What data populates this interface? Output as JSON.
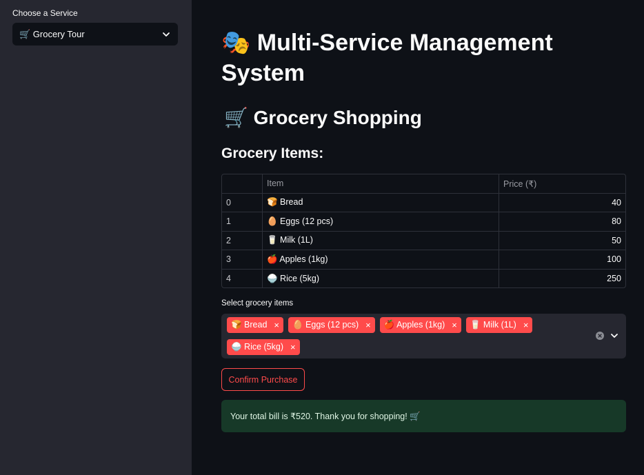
{
  "sidebar": {
    "label": "Choose a Service",
    "selected": "🛒 Grocery Tour"
  },
  "main": {
    "title": "🎭 Multi-Service Management System",
    "subtitle": "🛒 Grocery Shopping",
    "section_heading": "Grocery Items:",
    "table": {
      "columns": [
        "",
        "Item",
        "Price (₹)"
      ],
      "rows": [
        {
          "index": "0",
          "item": "🍞 Bread",
          "price": "40"
        },
        {
          "index": "1",
          "item": "🥚 Eggs (12 pcs)",
          "price": "80"
        },
        {
          "index": "2",
          "item": "🥛 Milk (1L)",
          "price": "50"
        },
        {
          "index": "3",
          "item": "🍎 Apples (1kg)",
          "price": "100"
        },
        {
          "index": "4",
          "item": "🍚 Rice (5kg)",
          "price": "250"
        }
      ]
    },
    "multiselect": {
      "label": "Select grocery items",
      "tags": [
        "🍞 Bread",
        "🥚 Eggs (12 pcs)",
        "🍎 Apples (1kg)",
        "🥛 Milk (1L)",
        "🍚 Rice (5kg)"
      ],
      "remove_glyph": "×"
    },
    "confirm_button": "Confirm Purchase",
    "alert": "Your total bill is ₹520. Thank you for shopping! 🛒"
  },
  "colors": {
    "accent": "#ff4b4b",
    "background": "#0e1117",
    "sidebar": "#262730",
    "success_bg": "#173928"
  }
}
